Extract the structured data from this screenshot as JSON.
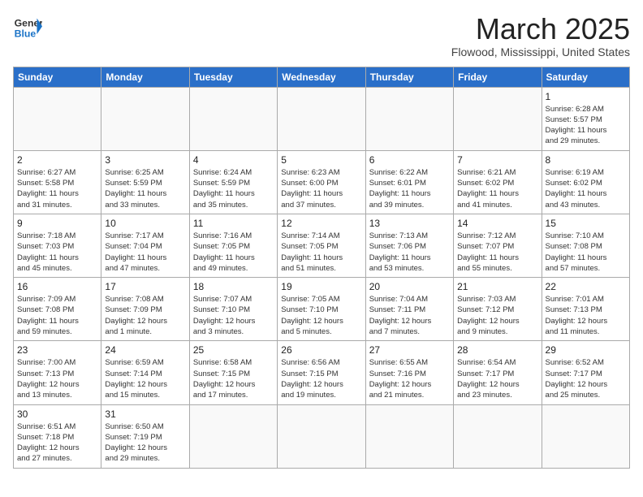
{
  "header": {
    "logo_general": "General",
    "logo_blue": "Blue",
    "month_title": "March 2025",
    "location": "Flowood, Mississippi, United States"
  },
  "days_of_week": [
    "Sunday",
    "Monday",
    "Tuesday",
    "Wednesday",
    "Thursday",
    "Friday",
    "Saturday"
  ],
  "weeks": [
    [
      null,
      null,
      null,
      null,
      null,
      null,
      {
        "day": "1",
        "info": "Sunrise: 6:28 AM\nSunset: 5:57 PM\nDaylight: 11 hours\nand 29 minutes."
      }
    ],
    [
      {
        "day": "2",
        "info": "Sunrise: 6:27 AM\nSunset: 5:58 PM\nDaylight: 11 hours\nand 31 minutes."
      },
      {
        "day": "3",
        "info": "Sunrise: 6:25 AM\nSunset: 5:59 PM\nDaylight: 11 hours\nand 33 minutes."
      },
      {
        "day": "4",
        "info": "Sunrise: 6:24 AM\nSunset: 5:59 PM\nDaylight: 11 hours\nand 35 minutes."
      },
      {
        "day": "5",
        "info": "Sunrise: 6:23 AM\nSunset: 6:00 PM\nDaylight: 11 hours\nand 37 minutes."
      },
      {
        "day": "6",
        "info": "Sunrise: 6:22 AM\nSunset: 6:01 PM\nDaylight: 11 hours\nand 39 minutes."
      },
      {
        "day": "7",
        "info": "Sunrise: 6:21 AM\nSunset: 6:02 PM\nDaylight: 11 hours\nand 41 minutes."
      },
      {
        "day": "8",
        "info": "Sunrise: 6:19 AM\nSunset: 6:02 PM\nDaylight: 11 hours\nand 43 minutes."
      }
    ],
    [
      {
        "day": "9",
        "info": "Sunrise: 7:18 AM\nSunset: 7:03 PM\nDaylight: 11 hours\nand 45 minutes."
      },
      {
        "day": "10",
        "info": "Sunrise: 7:17 AM\nSunset: 7:04 PM\nDaylight: 11 hours\nand 47 minutes."
      },
      {
        "day": "11",
        "info": "Sunrise: 7:16 AM\nSunset: 7:05 PM\nDaylight: 11 hours\nand 49 minutes."
      },
      {
        "day": "12",
        "info": "Sunrise: 7:14 AM\nSunset: 7:05 PM\nDaylight: 11 hours\nand 51 minutes."
      },
      {
        "day": "13",
        "info": "Sunrise: 7:13 AM\nSunset: 7:06 PM\nDaylight: 11 hours\nand 53 minutes."
      },
      {
        "day": "14",
        "info": "Sunrise: 7:12 AM\nSunset: 7:07 PM\nDaylight: 11 hours\nand 55 minutes."
      },
      {
        "day": "15",
        "info": "Sunrise: 7:10 AM\nSunset: 7:08 PM\nDaylight: 11 hours\nand 57 minutes."
      }
    ],
    [
      {
        "day": "16",
        "info": "Sunrise: 7:09 AM\nSunset: 7:08 PM\nDaylight: 11 hours\nand 59 minutes."
      },
      {
        "day": "17",
        "info": "Sunrise: 7:08 AM\nSunset: 7:09 PM\nDaylight: 12 hours\nand 1 minute."
      },
      {
        "day": "18",
        "info": "Sunrise: 7:07 AM\nSunset: 7:10 PM\nDaylight: 12 hours\nand 3 minutes."
      },
      {
        "day": "19",
        "info": "Sunrise: 7:05 AM\nSunset: 7:10 PM\nDaylight: 12 hours\nand 5 minutes."
      },
      {
        "day": "20",
        "info": "Sunrise: 7:04 AM\nSunset: 7:11 PM\nDaylight: 12 hours\nand 7 minutes."
      },
      {
        "day": "21",
        "info": "Sunrise: 7:03 AM\nSunset: 7:12 PM\nDaylight: 12 hours\nand 9 minutes."
      },
      {
        "day": "22",
        "info": "Sunrise: 7:01 AM\nSunset: 7:13 PM\nDaylight: 12 hours\nand 11 minutes."
      }
    ],
    [
      {
        "day": "23",
        "info": "Sunrise: 7:00 AM\nSunset: 7:13 PM\nDaylight: 12 hours\nand 13 minutes."
      },
      {
        "day": "24",
        "info": "Sunrise: 6:59 AM\nSunset: 7:14 PM\nDaylight: 12 hours\nand 15 minutes."
      },
      {
        "day": "25",
        "info": "Sunrise: 6:58 AM\nSunset: 7:15 PM\nDaylight: 12 hours\nand 17 minutes."
      },
      {
        "day": "26",
        "info": "Sunrise: 6:56 AM\nSunset: 7:15 PM\nDaylight: 12 hours\nand 19 minutes."
      },
      {
        "day": "27",
        "info": "Sunrise: 6:55 AM\nSunset: 7:16 PM\nDaylight: 12 hours\nand 21 minutes."
      },
      {
        "day": "28",
        "info": "Sunrise: 6:54 AM\nSunset: 7:17 PM\nDaylight: 12 hours\nand 23 minutes."
      },
      {
        "day": "29",
        "info": "Sunrise: 6:52 AM\nSunset: 7:17 PM\nDaylight: 12 hours\nand 25 minutes."
      }
    ],
    [
      {
        "day": "30",
        "info": "Sunrise: 6:51 AM\nSunset: 7:18 PM\nDaylight: 12 hours\nand 27 minutes."
      },
      {
        "day": "31",
        "info": "Sunrise: 6:50 AM\nSunset: 7:19 PM\nDaylight: 12 hours\nand 29 minutes."
      },
      null,
      null,
      null,
      null,
      null
    ]
  ]
}
